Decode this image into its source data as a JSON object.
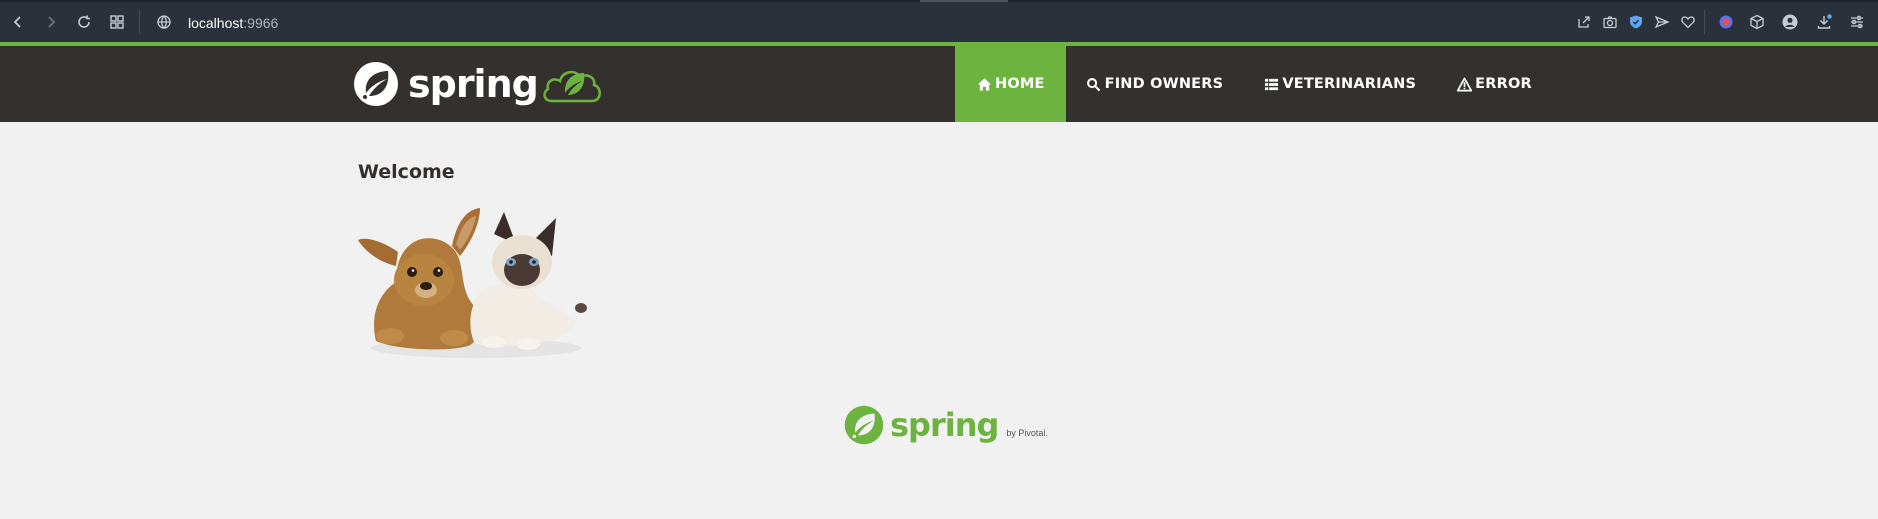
{
  "browser": {
    "url_host": "localhost",
    "url_port": ":9966",
    "icons": [
      "back-icon",
      "forward-icon",
      "reload-icon",
      "tabs-grid-icon",
      "site-info-icon",
      "share-icon",
      "camera-icon",
      "shield-icon",
      "send-icon",
      "heart-icon",
      "extension-icon",
      "cube-icon",
      "profile-icon",
      "download-icon",
      "settings-sliders-icon"
    ]
  },
  "header": {
    "logo_text": "spring",
    "nav": [
      {
        "label": "HOME",
        "icon": "home-icon",
        "active": true
      },
      {
        "label": "FIND OWNERS",
        "icon": "search-icon",
        "active": false
      },
      {
        "label": "VETERINARIANS",
        "icon": "list-icon",
        "active": false
      },
      {
        "label": "ERROR",
        "icon": "warning-icon",
        "active": false
      }
    ]
  },
  "main": {
    "title": "Welcome"
  },
  "footer": {
    "logo_text": "spring",
    "by_text": "by Pivotal."
  },
  "colors": {
    "brand_green": "#6db33f",
    "navbar_bg": "#34302d",
    "page_bg": "#f1f1f1",
    "chrome_bg": "#2b313b"
  }
}
